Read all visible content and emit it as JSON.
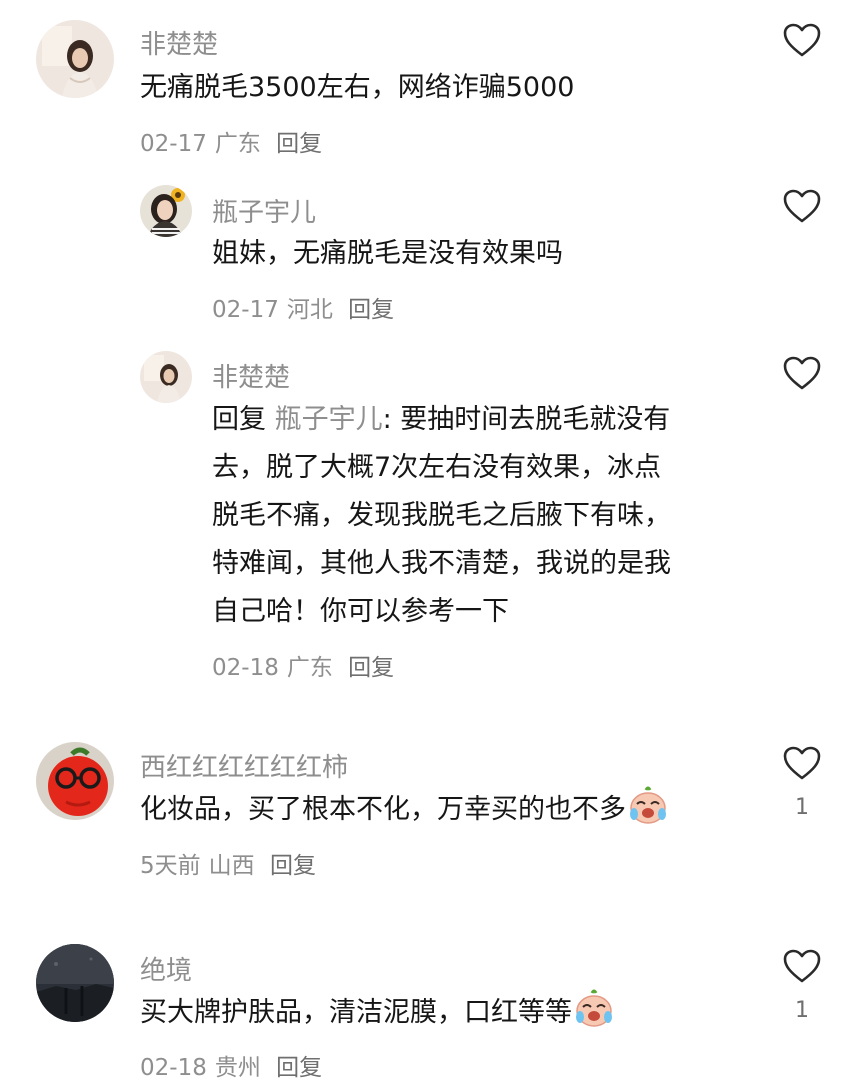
{
  "comments": [
    {
      "username": "非楚楚",
      "text": "无痛脱毛3500左右，网络诈骗5000",
      "date": "02-17",
      "location": "广东",
      "reply_label": "回复",
      "replies": [
        {
          "username": "瓶子宇儿",
          "text": "姐妹，无痛脱毛是没有效果吗",
          "date": "02-17",
          "location": "河北",
          "reply_label": "回复"
        },
        {
          "username": "非楚楚",
          "reply_prefix": "回复",
          "reply_to": "瓶子宇儿",
          "text_lines": [
            ": 要抽时间去脱毛就没有",
            "去，脱了大概7次左右没有效果，冰点",
            "脱毛不痛，发现我脱毛之后腋下有味，",
            "特难闻，其他人我不清楚，我说的是我",
            "自己哈！你可以参考一下"
          ],
          "date": "02-18",
          "location": "广东",
          "reply_label": "回复"
        }
      ]
    },
    {
      "username": "西红红红红红红柿",
      "text": "化妆品，买了根本不化，万幸买的也不多",
      "date": "5天前",
      "location": "山西",
      "reply_label": "回复",
      "likes": "1"
    },
    {
      "username": "绝境",
      "text": "买大牌护肤品，清洁泥膜，口红等等",
      "date": "02-18",
      "location": "贵州",
      "reply_label": "回复",
      "likes": "1"
    }
  ],
  "icons": {
    "like": "heart-outline-icon",
    "emoji": "crying-face-emoji"
  },
  "colors": {
    "username": "#8e8e8e",
    "text": "#161616",
    "meta": "#8e8e8e"
  }
}
